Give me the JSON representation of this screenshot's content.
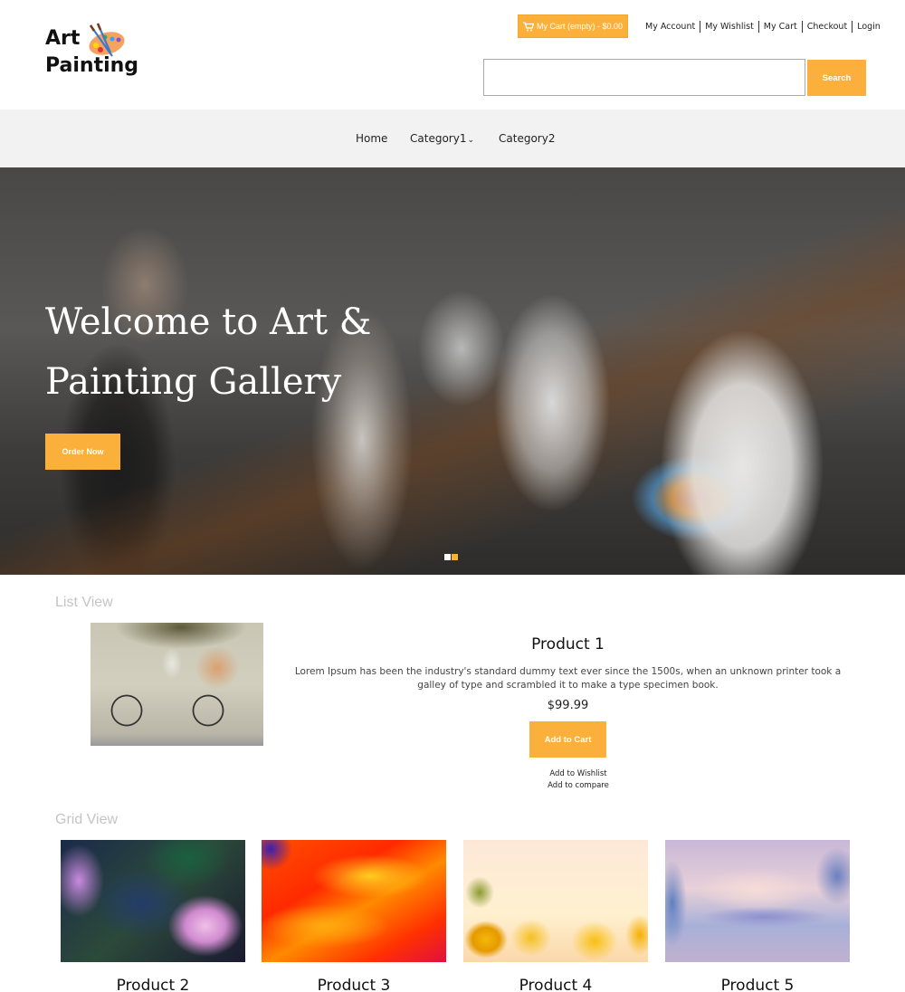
{
  "header": {
    "logo": {
      "line1": "Art",
      "line2": "Painting"
    },
    "cart_button": "My Cart (empty) - $0.00",
    "top_links": [
      "My Account",
      "My Wishlist",
      "My Cart",
      "Checkout",
      "Login"
    ],
    "search": {
      "placeholder": "",
      "value": "",
      "button": "Search"
    }
  },
  "nav": {
    "items": [
      {
        "label": "Home"
      },
      {
        "label": "Category1",
        "has_dropdown": true,
        "chevron": "⌄"
      },
      {
        "label": "Category2"
      }
    ]
  },
  "hero": {
    "title": "Welcome to Art & Painting Gallery",
    "button": "Order Now",
    "slides": 2,
    "active_slide": 2
  },
  "list_view": {
    "label": "List View",
    "product": {
      "title": "Product 1",
      "description": "Lorem Ipsum has been the industry's standard dummy text ever since the 1500s, when an unknown printer took a galley of type and scrambled it to make a type specimen book.",
      "price": "$99.99",
      "add_to_cart": "Add to Cart",
      "add_to_wishlist": "Add to Wishlist",
      "add_to_compare": "Add to compare"
    }
  },
  "grid_view": {
    "label": "Grid View",
    "products": [
      {
        "title": "Product 2"
      },
      {
        "title": "Product 3"
      },
      {
        "title": "Product 4"
      },
      {
        "title": "Product 5"
      }
    ]
  },
  "colors": {
    "accent": "#fbb03b",
    "nav_bg": "#f2f2f2",
    "section_label": "#c4c4c4"
  }
}
